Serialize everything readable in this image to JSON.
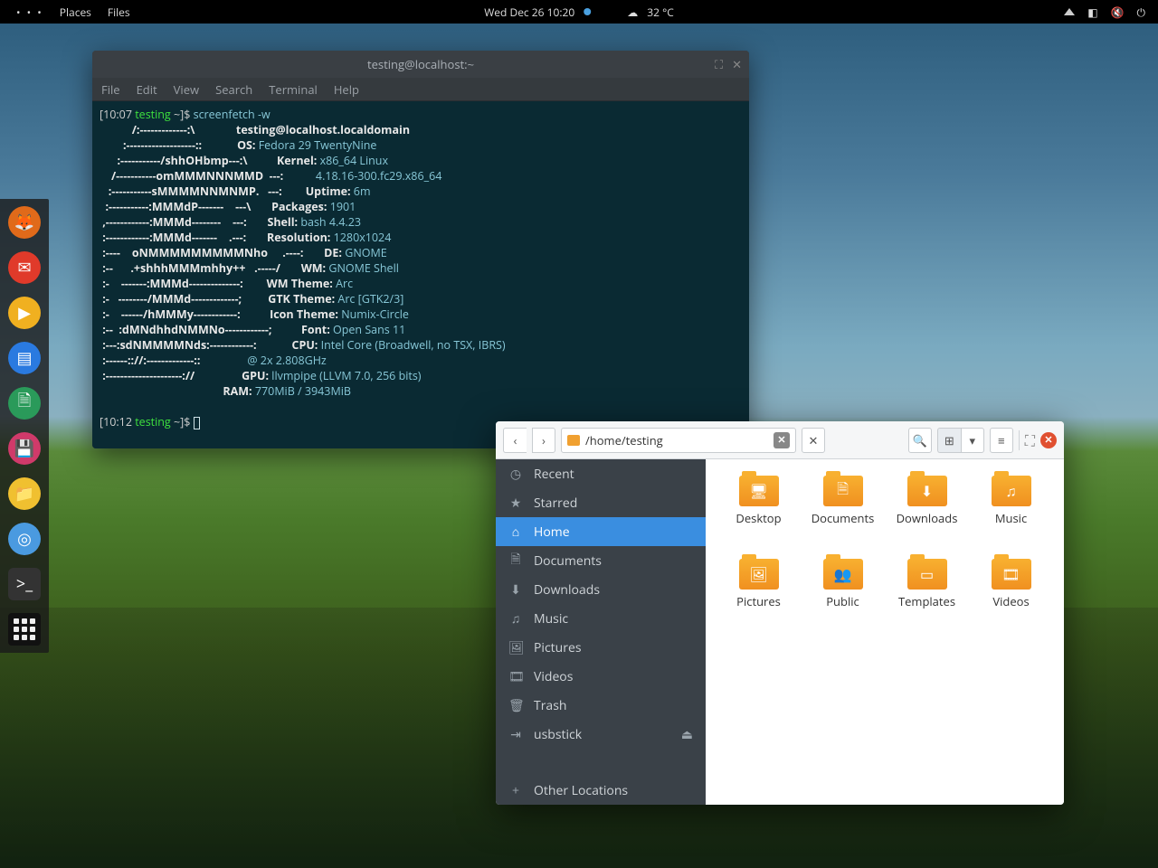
{
  "topbar": {
    "places": "Places",
    "files": "Files",
    "datetime": "Wed Dec 26  10:20",
    "weather": "32 °C"
  },
  "dock": {
    "items": [
      "firefox",
      "mail",
      "media",
      "text-editor",
      "document",
      "save",
      "folder",
      "screenshot",
      "terminal",
      "apps-grid"
    ]
  },
  "terminal": {
    "title": "testing@localhost:~",
    "menu": [
      "File",
      "Edit",
      "View",
      "Search",
      "Terminal",
      "Help"
    ],
    "prompt1_time": "[10:07 ",
    "prompt1_user": "testing",
    "prompt1_rest": " ~]$ ",
    "cmd": "screenfetch -w",
    "ascii": [
      "           /:-------------:\\",
      "        :-------------------::",
      "      :-----------/shhOHbmp---:\\",
      "    /-----------omMMMNNNMMD  ---:",
      "   :-----------sMMMMNNMNMP.   ---:",
      "  :-----------:MMMdP-------    ---\\",
      " ,------------:MMMd--------    ---:",
      " :------------:MMMd-------    .---:",
      " :----    oNMMMMMMMMMNho     .----:",
      " :--      .+shhhMMMmhhy++   .-----/",
      " :-    -------:MMMd--------------:",
      " :-   --------/MMMd-------------;",
      " :-    ------/hMMMy------------:",
      " :--  :dMNdhhdNMMNo------------;",
      " :---:sdNMMMMNds:------------:",
      " :------:://:-------------::",
      " :---------------------://"
    ],
    "info": [
      {
        "k": "",
        "v": "testing@localhost.localdomain",
        "host": true
      },
      {
        "k": "OS:",
        "v": " Fedora 29 TwentyNine"
      },
      {
        "k": "Kernel:",
        "v": " x86_64 Linux"
      },
      {
        "k": "",
        "v": "  4.18.16-300.fc29.x86_64",
        "cont": true
      },
      {
        "k": "Uptime:",
        "v": " 6m"
      },
      {
        "k": "Packages:",
        "v": " 1901"
      },
      {
        "k": "Shell:",
        "v": " bash 4.4.23"
      },
      {
        "k": "Resolution:",
        "v": " 1280x1024"
      },
      {
        "k": "DE:",
        "v": " GNOME"
      },
      {
        "k": "WM:",
        "v": " GNOME Shell"
      },
      {
        "k": "WM Theme:",
        "v": " Arc"
      },
      {
        "k": "GTK Theme:",
        "v": " Arc [GTK2/3]"
      },
      {
        "k": "Icon Theme:",
        "v": " Numix-Circle"
      },
      {
        "k": "Font:",
        "v": " Open Sans 11"
      },
      {
        "k": "CPU:",
        "v": " Intel Core (Broadwell, no TSX, IBRS)"
      },
      {
        "k": "",
        "v": "  @ 2x 2.808GHz",
        "cont": true
      },
      {
        "k": "GPU:",
        "v": " llvmpipe (LLVM 7.0, 256 bits)"
      },
      {
        "k": "RAM:",
        "v": " 770MiB / 3943MiB"
      }
    ],
    "prompt2_time": "[10:12 ",
    "prompt2_user": "testing",
    "prompt2_rest": " ~]$ "
  },
  "fm": {
    "path": "/home/testing",
    "sidebar": [
      {
        "icon": "◷",
        "label": "Recent"
      },
      {
        "icon": "★",
        "label": "Starred"
      },
      {
        "icon": "⌂",
        "label": "Home",
        "active": true
      },
      {
        "icon": "🗎",
        "label": "Documents"
      },
      {
        "icon": "⬇",
        "label": "Downloads"
      },
      {
        "icon": "♫",
        "label": "Music"
      },
      {
        "icon": "🖼",
        "label": "Pictures"
      },
      {
        "icon": "🎞",
        "label": "Videos"
      },
      {
        "icon": "🗑",
        "label": "Trash"
      },
      {
        "icon": "⇥",
        "label": "usbstick",
        "eject": true
      },
      {
        "icon": "+",
        "label": "Other Locations"
      }
    ],
    "folders": [
      {
        "name": "Desktop",
        "glyph": "🖥"
      },
      {
        "name": "Documents",
        "glyph": "🗎"
      },
      {
        "name": "Downloads",
        "glyph": "⬇"
      },
      {
        "name": "Music",
        "glyph": "♫"
      },
      {
        "name": "Pictures",
        "glyph": "🖼"
      },
      {
        "name": "Public",
        "glyph": "👥"
      },
      {
        "name": "Templates",
        "glyph": "▭"
      },
      {
        "name": "Videos",
        "glyph": "🎞"
      }
    ]
  },
  "dock_colors": [
    "#e06a1a",
    "#e03a2a",
    "#f0b020",
    "#2a7ae0",
    "#2a9a5a",
    "#d03a6a",
    "#f0c030",
    "#4a9ae0",
    "#333",
    "#111"
  ]
}
